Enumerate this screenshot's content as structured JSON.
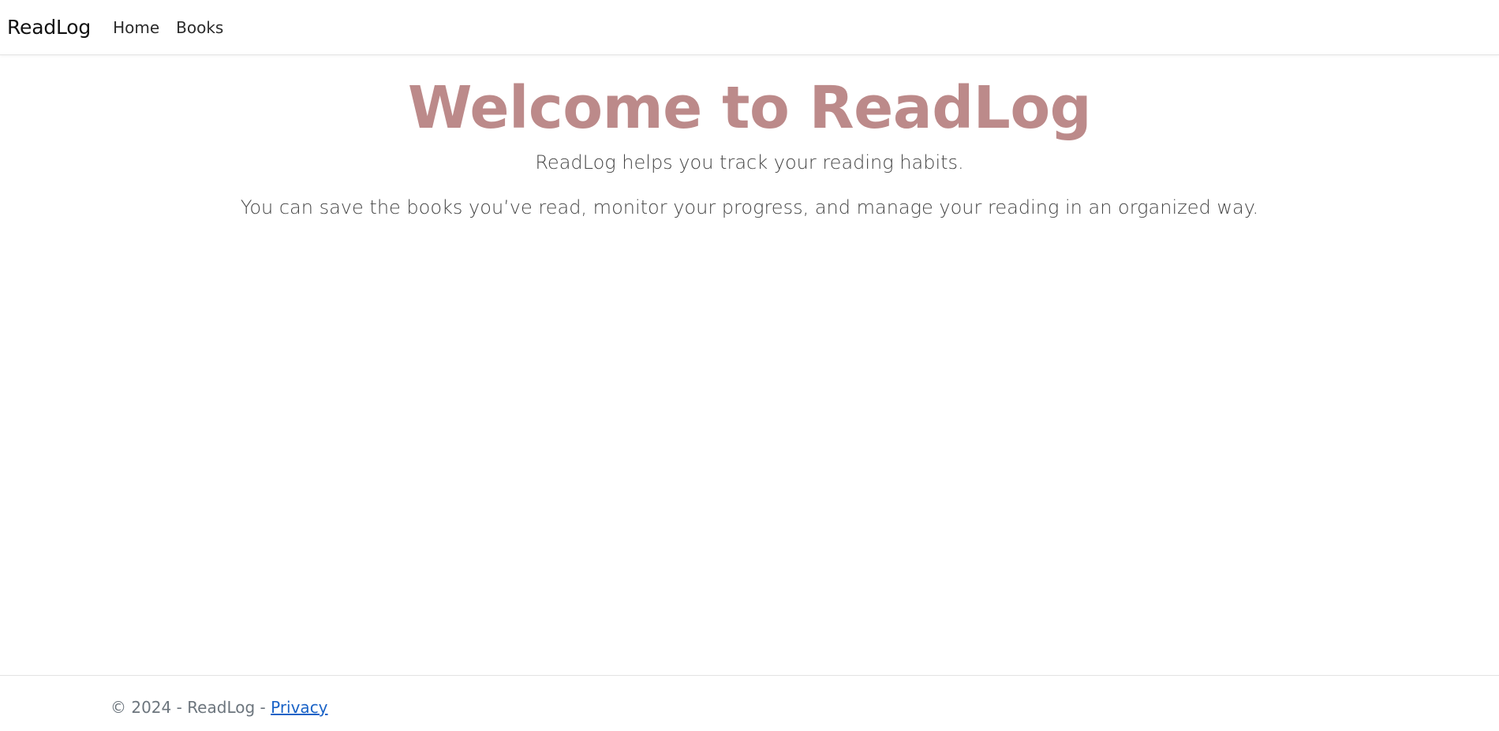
{
  "navbar": {
    "brand": "ReadLog",
    "links": [
      {
        "label": "Home"
      },
      {
        "label": "Books"
      }
    ]
  },
  "hero": {
    "title": "Welcome to ReadLog",
    "subtitle": "ReadLog helps you track your reading habits.",
    "description": "You can save the books you’ve read, monitor your progress, and manage your reading in an organized way."
  },
  "footer": {
    "copyright": "© 2024 - ReadLog -",
    "privacy_label": "Privacy"
  },
  "colors": {
    "title": "#bc8a8a",
    "link": "#1a63c7",
    "footer_text": "#6c757d"
  }
}
